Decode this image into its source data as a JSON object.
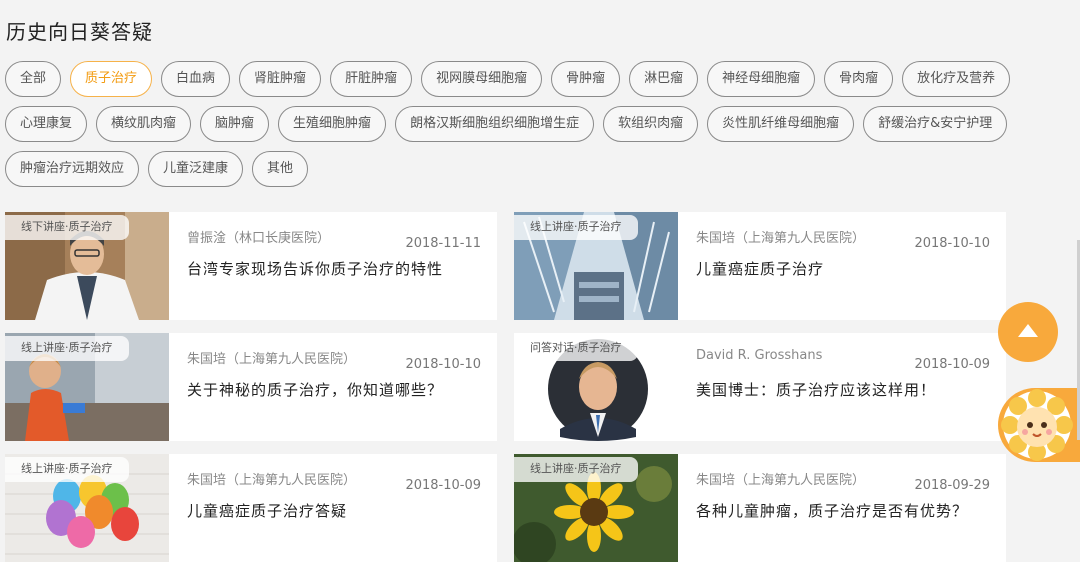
{
  "page_title": "历史向日葵答疑",
  "tag_rows": [
    [
      "全部",
      "质子治疗",
      "白血病",
      "肾脏肿瘤",
      "肝脏肿瘤",
      "视网膜母细胞瘤",
      "骨肿瘤",
      "淋巴瘤",
      "神经母细胞瘤",
      "骨肉瘤",
      "放化疗及营养"
    ],
    [
      "心理康复",
      "横纹肌肉瘤",
      "脑肿瘤",
      "生殖细胞肿瘤",
      "朗格汉斯细胞组织细胞增生症",
      "软组织肉瘤",
      "炎性肌纤维母细胞瘤",
      "舒缓治疗&安宁护理"
    ],
    [
      "肿瘤治疗远期效应",
      "儿童泛建康",
      "其他"
    ]
  ],
  "active_tag": "质子治疗",
  "articles": [
    {
      "badge": "线下讲座·质子治疗",
      "author": "曾振淦（林口长庚医院）",
      "date": "2018-11-11",
      "title": "台湾专家现场告诉你质子治疗的特性",
      "image": "doctor-photo"
    },
    {
      "badge": "线上讲座·质子治疗",
      "author": "朱国培（上海第九人民医院）",
      "date": "2018-10-10",
      "title": "儿童癌症质子治疗",
      "image": "building-photo"
    },
    {
      "badge": "线上讲座·质子治疗",
      "author": "朱国培（上海第九人民医院）",
      "date": "2018-10-10",
      "title": "关于神秘的质子治疗，你知道哪些？",
      "image": "child-photo"
    },
    {
      "badge": "问答对话·质子治疗",
      "author": "David R. Grosshans",
      "date": "2018-10-09",
      "title": "美国博士：质子治疗应该这样用！",
      "image": "portrait-photo"
    },
    {
      "badge": "线上讲座·质子治疗",
      "author": "朱国培（上海第九人民医院）",
      "date": "2018-10-09",
      "title": "儿童癌症质子治疗答疑",
      "image": "balloons-photo"
    },
    {
      "badge": "线上讲座·质子治疗",
      "author": "朱国培（上海第九人民医院）",
      "date": "2018-09-29",
      "title": "各种儿童肿瘤，质子治疗是否有优势？",
      "image": "sunflower-photo"
    }
  ],
  "colors": {
    "accent": "#f8a93c",
    "active_tag_text": "#f39c12"
  },
  "icons": {
    "scroll_top": "arrow-up-icon",
    "mascot": "sunflower-mascot-icon"
  }
}
